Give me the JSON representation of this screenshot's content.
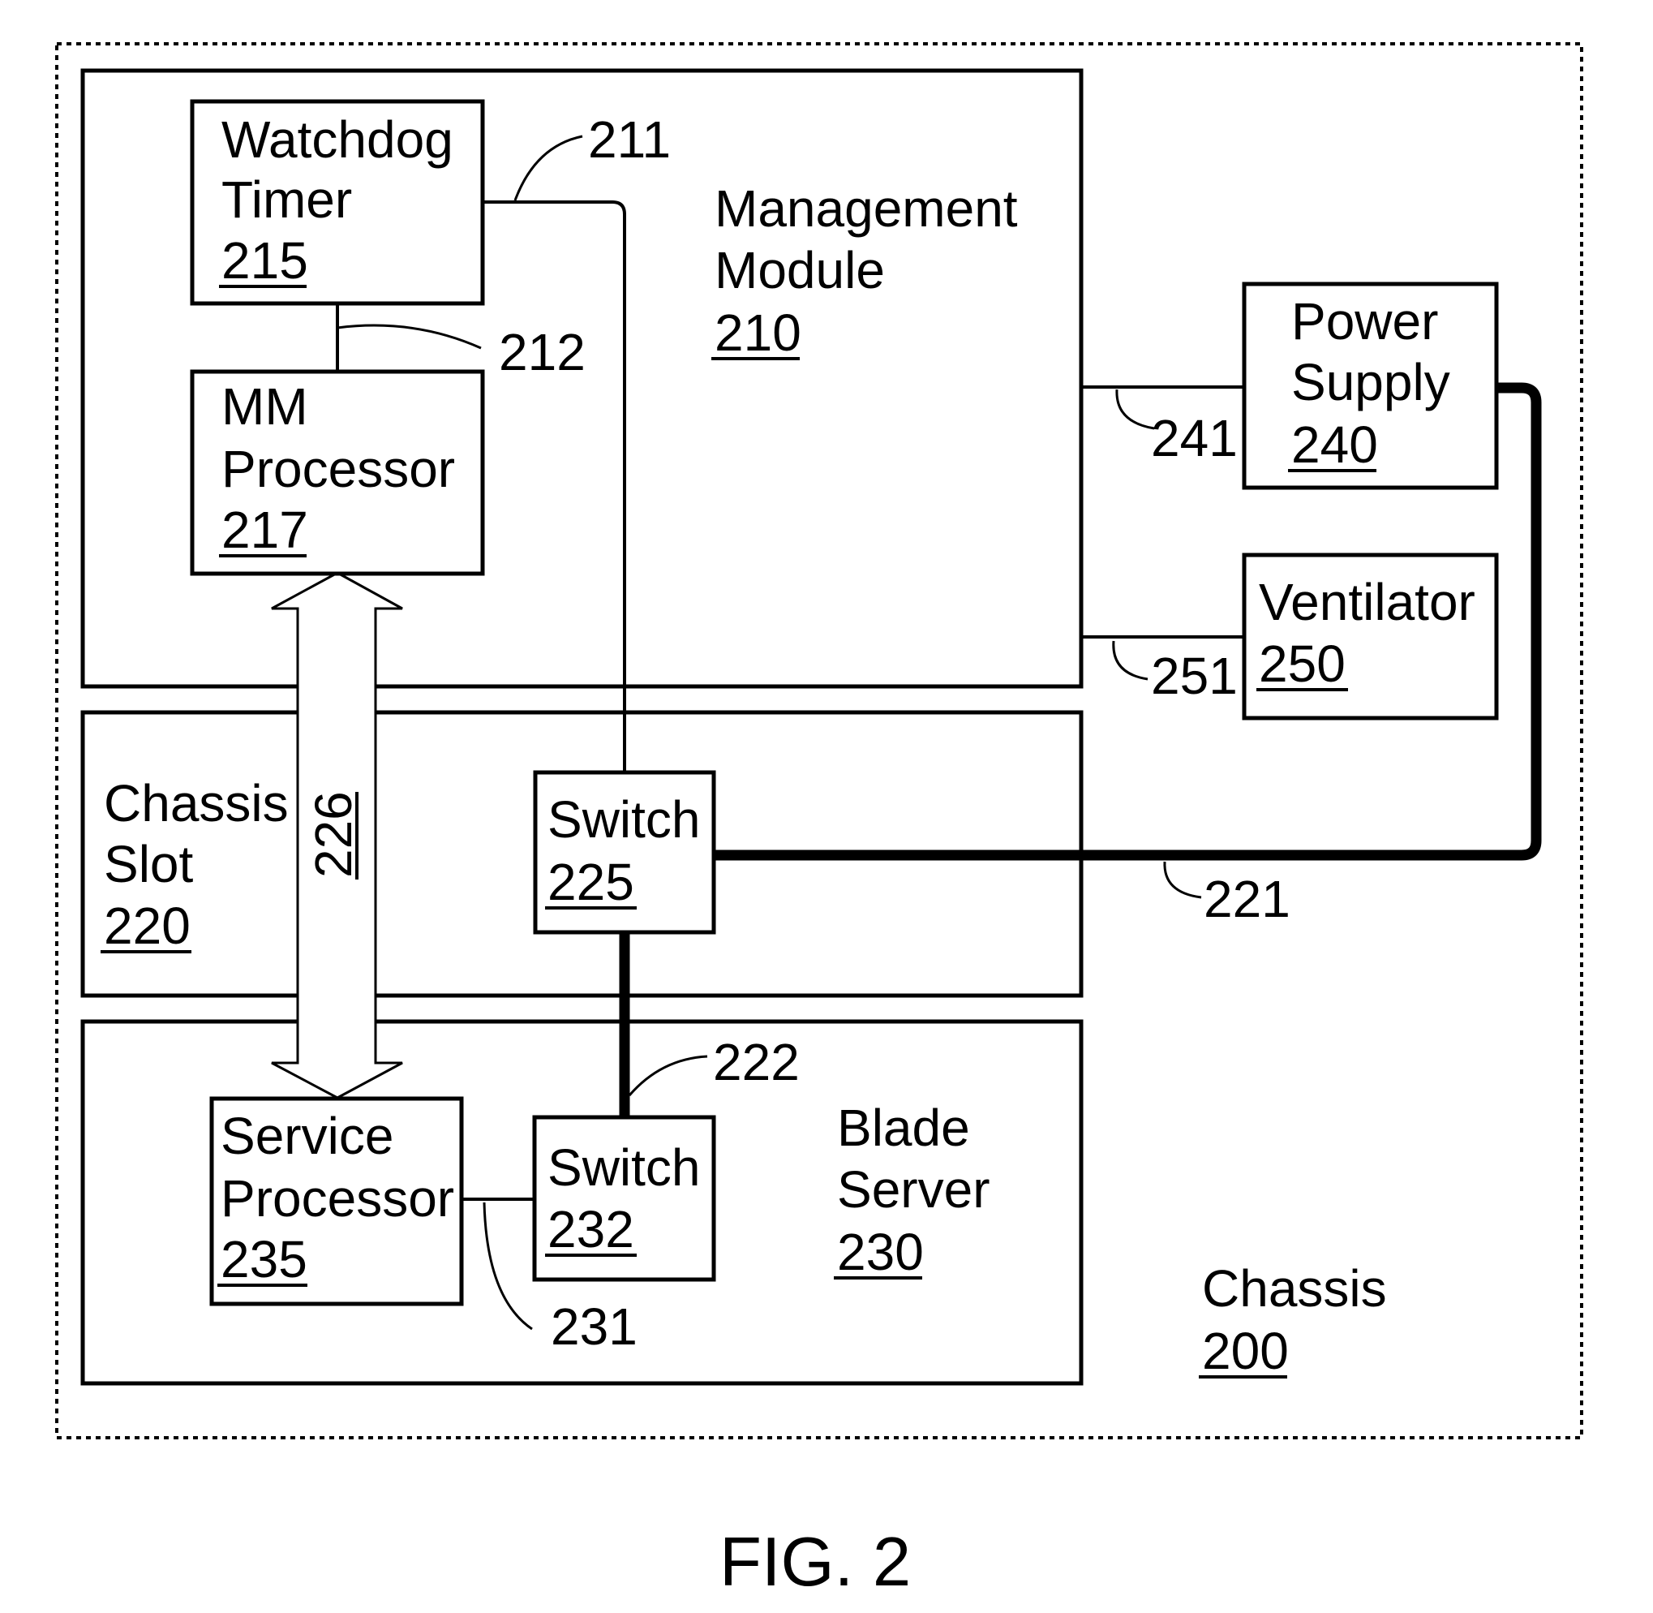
{
  "figure": {
    "caption": "FIG. 2",
    "type": "block diagram"
  },
  "chassis": {
    "lines": [
      "Chassis"
    ],
    "ref": "200"
  },
  "components": {
    "management_module": {
      "lines": [
        "Management",
        "Module"
      ],
      "ref": "210"
    },
    "watchdog_timer": {
      "lines": [
        "Watchdog",
        "Timer"
      ],
      "ref": "215"
    },
    "mm_processor": {
      "lines": [
        "MM",
        "Processor"
      ],
      "ref": "217"
    },
    "chassis_slot": {
      "lines": [
        "Chassis",
        "Slot"
      ],
      "ref": "220"
    },
    "switch_225": {
      "lines": [
        "Switch"
      ],
      "ref": "225"
    },
    "blade_server": {
      "lines": [
        "Blade",
        "Server"
      ],
      "ref": "230"
    },
    "switch_232": {
      "lines": [
        "Switch"
      ],
      "ref": "232"
    },
    "service_processor": {
      "lines": [
        "Service",
        "Processor"
      ],
      "ref": "235"
    },
    "power_supply": {
      "lines": [
        "Power",
        "Supply"
      ],
      "ref": "240"
    },
    "ventilator": {
      "lines": [
        "Ventilator"
      ],
      "ref": "250"
    }
  },
  "connections": {
    "c211": {
      "ref": "211",
      "from": "Watchdog Timer 215",
      "to": "Switch 225",
      "style": "thin"
    },
    "c212": {
      "ref": "212",
      "from": "Watchdog Timer 215",
      "to": "MM Processor 217",
      "style": "thin"
    },
    "c221": {
      "ref": "221",
      "from": "Switch 225",
      "to": "Power Supply 240",
      "style": "thick"
    },
    "c222": {
      "ref": "222",
      "from": "Switch 225",
      "to": "Switch 232",
      "style": "thick"
    },
    "c226": {
      "ref": "226",
      "from": "MM Processor 217",
      "to": "Service Processor 235",
      "style": "double-arrow"
    },
    "c231": {
      "ref": "231",
      "from": "Service Processor 235",
      "to": "Switch 232",
      "style": "thin"
    },
    "c241": {
      "ref": "241",
      "from": "Management Module 210",
      "to": "Power Supply 240",
      "style": "thin"
    },
    "c251": {
      "ref": "251",
      "from": "Management Module 210",
      "to": "Ventilator 250",
      "style": "thin"
    }
  }
}
